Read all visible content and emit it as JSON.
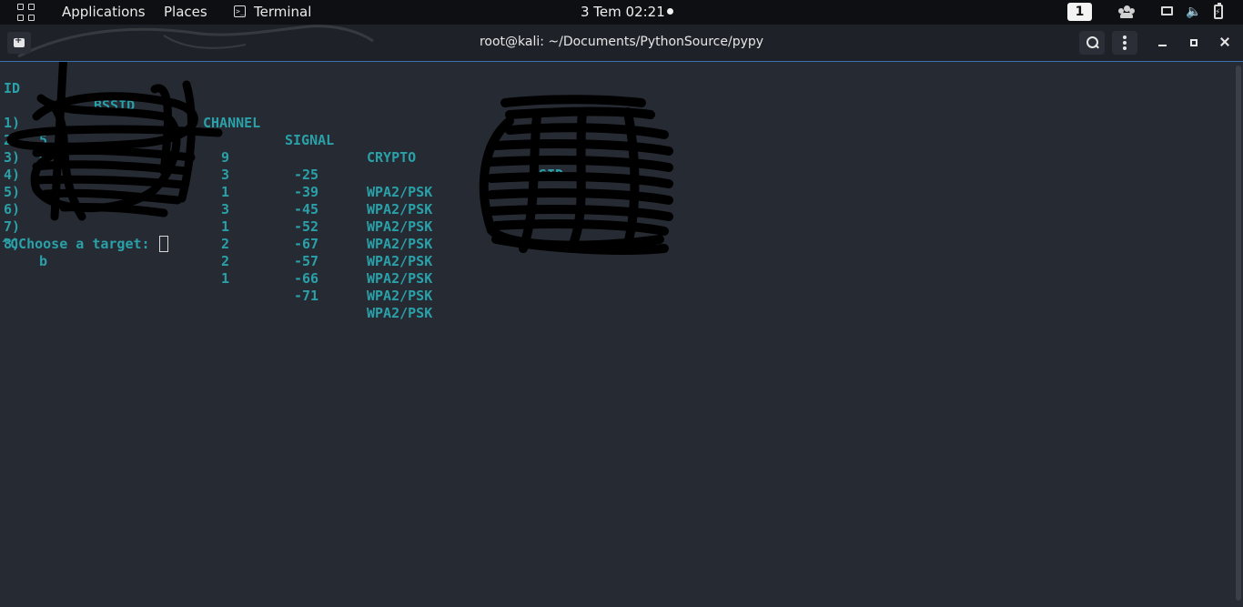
{
  "topbar": {
    "applications": "Applications",
    "places": "Places",
    "terminal_app": "Terminal",
    "clock": "3 Tem  02:21",
    "workspace": "1"
  },
  "window": {
    "title": "root@kali: ~/Documents/PythonSource/pypy"
  },
  "terminal": {
    "headers": {
      "id": "ID",
      "bssid": "BSSID",
      "channel": "CHANNEL",
      "signal": "SIGNAL",
      "crypto": "CRYPTO",
      "ssid": "SSID"
    },
    "rows": [
      {
        "id": "1)",
        "bssid": "5",
        "channel": "9",
        "signal": "-25",
        "crypto": "WPA2/PSK"
      },
      {
        "id": "2)",
        "bssid": "e",
        "channel": "3",
        "signal": "-39",
        "crypto": "WPA2/PSK"
      },
      {
        "id": "3)",
        "bssid": "",
        "channel": "1",
        "signal": "-45",
        "crypto": "WPA2/PSK"
      },
      {
        "id": "4)",
        "bssid": "",
        "channel": "3",
        "signal": "-52",
        "crypto": "WPA2/PSK"
      },
      {
        "id": "5)",
        "bssid": "",
        "channel": "1",
        "signal": "-67",
        "crypto": "WPA2/PSK"
      },
      {
        "id": "6)",
        "bssid": "",
        "channel": "2",
        "signal": "-57",
        "crypto": "WPA2/PSK"
      },
      {
        "id": "7)",
        "bssid": "",
        "channel": "2",
        "signal": "-66",
        "crypto": "WPA2/PSK"
      },
      {
        "id": "8)",
        "bssid": "b",
        "channel": "1",
        "signal": "-71",
        "crypto": "WPA2/PSK"
      }
    ],
    "prompt": "^CChoose a target: "
  },
  "colors": {
    "terminal_bg": "#262a33",
    "terminal_text": "#2aa0a8",
    "topbar_bg": "#0e0f12",
    "headerbar_bg": "#1f2128",
    "accent_border": "#3a6fb0"
  }
}
